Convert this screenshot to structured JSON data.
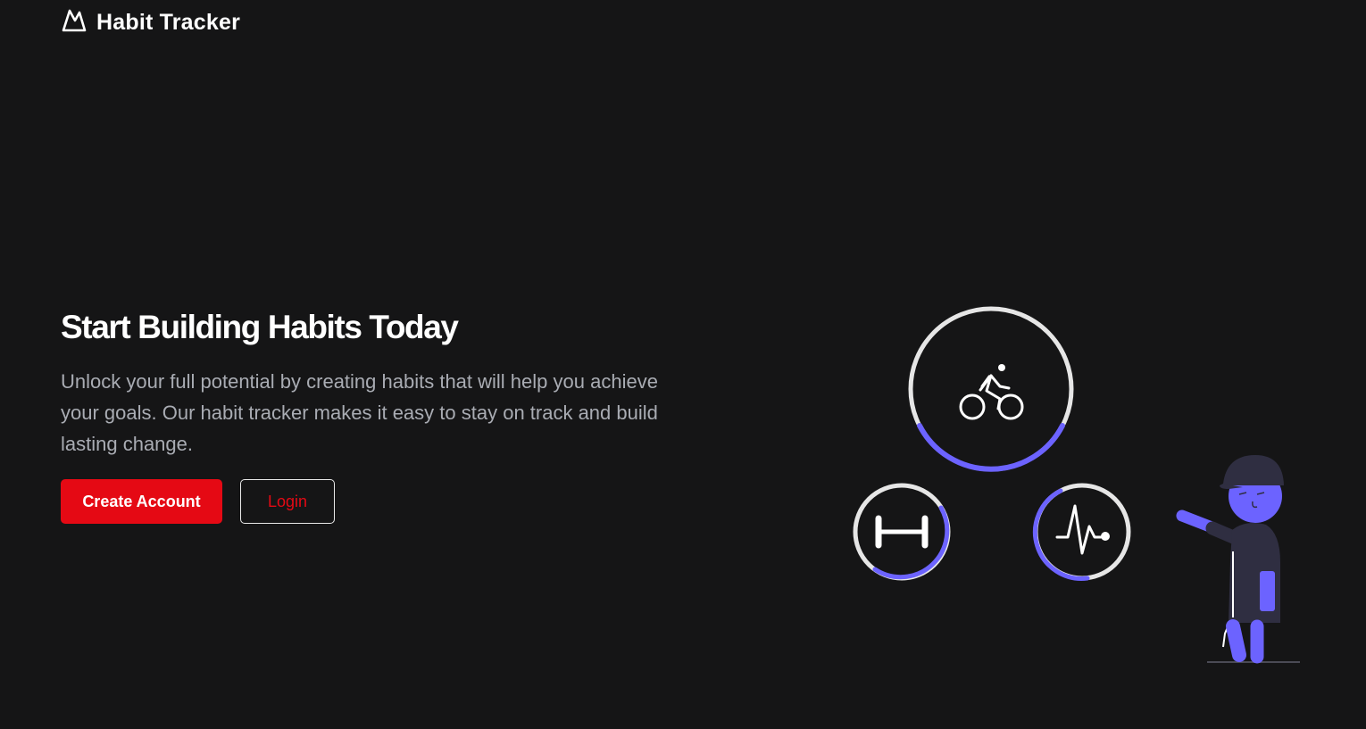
{
  "header": {
    "app_title": "Habit Tracker",
    "logo_icon": "mountain-icon"
  },
  "hero": {
    "heading": "Start Building Habits Today",
    "description": "Unlock your full potential by creating habits that will help you achieve your goals. Our habit tracker makes it easy to stay on track and build lasting change."
  },
  "actions": {
    "create_account_label": "Create Account",
    "login_label": "Login"
  },
  "illustration": {
    "rings": [
      {
        "icon": "bicycle-icon",
        "progress": 0.35
      },
      {
        "icon": "dumbbell-icon",
        "progress": 0.4
      },
      {
        "icon": "heartbeat-icon",
        "progress": 0.3
      }
    ],
    "person": "person-pointing"
  },
  "colors": {
    "background": "#151516",
    "accent": "#e50914",
    "progress": "#6c63ff",
    "ring": "#e6e6e6",
    "text_muted": "#a9acb3"
  }
}
